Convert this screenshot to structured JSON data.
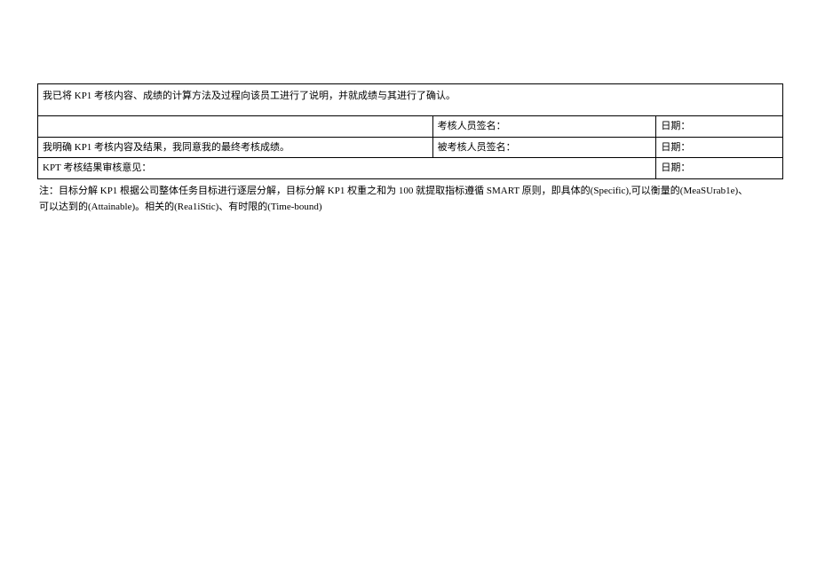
{
  "table": {
    "row1": {
      "text": "我已将 KP1 考核内容、成绩的计算方法及过程向该员工进行了说明，并就成绩与其进行了确认。"
    },
    "row2": {
      "cell1": "",
      "cell2": "考核人员签名：",
      "cell3": "日期："
    },
    "row3": {
      "cell1": "我明确 KP1 考核内容及结果，我同意我的最终考核成绩。",
      "cell2": "被考核人员签名：",
      "cell3": "日期："
    },
    "row4": {
      "cell1": "KPT 考核结果审核意见：",
      "cell2": "日期："
    }
  },
  "note": {
    "line1": "注：目标分解 KP1 根据公司整体任务目标进行逐层分解，目标分解 KP1 权重之和为 100 就提取指标遵循 SMART 原则，即具体的(Specific),可以衡量的(MeaSUrab1e)、",
    "line2": "可以达到的(Attainable)。相关的(Rea1iStic)、有时限的(Time-bound)"
  }
}
